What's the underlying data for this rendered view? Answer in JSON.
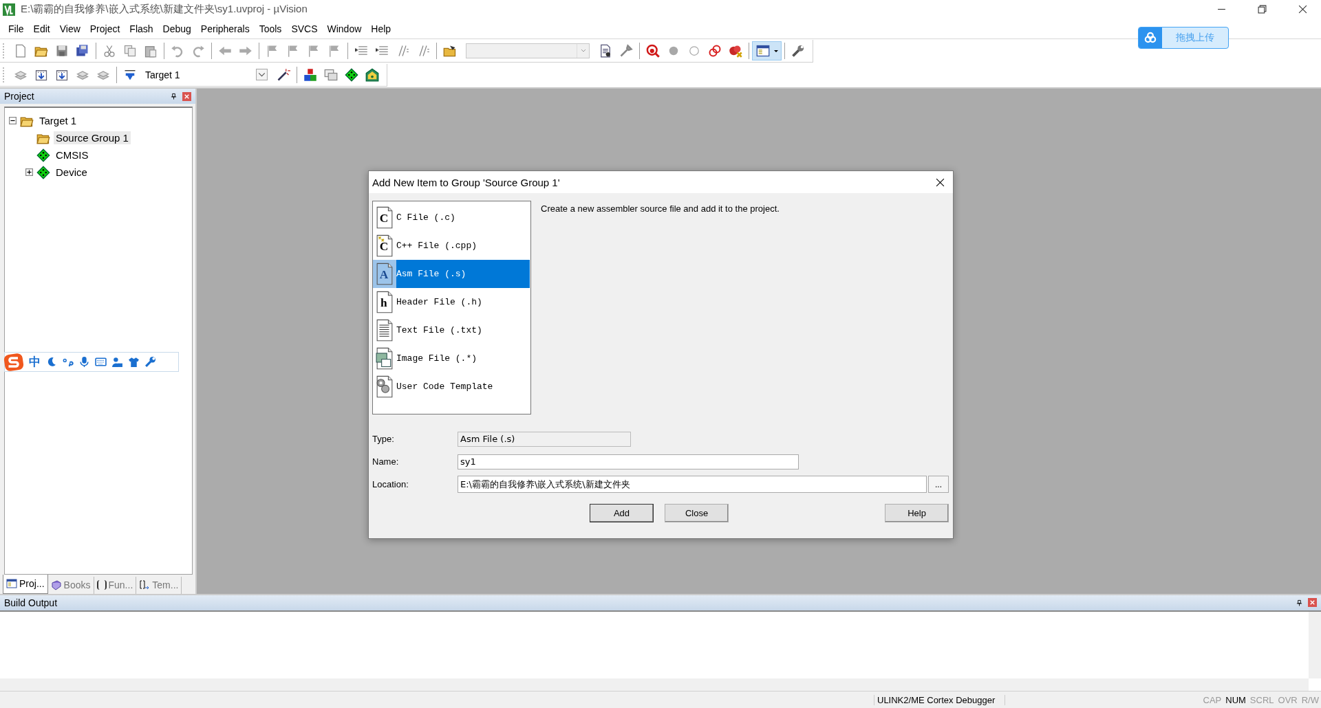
{
  "window": {
    "title": "E:\\霸霸的自我修养\\嵌入式系统\\新建文件夹\\sy1.uvproj - µVision"
  },
  "menu": [
    "File",
    "Edit",
    "View",
    "Project",
    "Flash",
    "Debug",
    "Peripherals",
    "Tools",
    "SVCS",
    "Window",
    "Help"
  ],
  "toolbar": {
    "target_select": "Target 1"
  },
  "upload_button": "拖拽上传",
  "ime_toolbar": {
    "mode": "中"
  },
  "project_panel": {
    "title": "Project",
    "tree": [
      {
        "label": "Target 1",
        "kind": "target",
        "expanded": true,
        "selected": false,
        "children": [
          {
            "label": "Source Group 1",
            "kind": "group",
            "selected": true
          },
          {
            "label": "CMSIS",
            "kind": "component",
            "selected": false
          },
          {
            "label": "Device",
            "kind": "component",
            "expanded": false,
            "selected": false
          }
        ]
      }
    ],
    "tabs": [
      {
        "label": "Proj...",
        "kind": "project",
        "selected": true
      },
      {
        "label": "Books",
        "kind": "books",
        "selected": false
      },
      {
        "label": "Fun...",
        "kind": "functions",
        "selected": false
      },
      {
        "label": "Tem...",
        "kind": "templates",
        "selected": false
      }
    ]
  },
  "dialog": {
    "title": "Add New Item to Group 'Source Group 1'",
    "items": [
      {
        "label": "C File (.c)",
        "kind": "c",
        "icon_letter": "C",
        "selected": false
      },
      {
        "label": "C++ File (.cpp)",
        "kind": "cpp",
        "icon_letter": "C",
        "selected": false
      },
      {
        "label": "Asm File (.s)",
        "kind": "asm",
        "icon_letter": "A",
        "selected": true
      },
      {
        "label": "Header File (.h)",
        "kind": "header",
        "icon_letter": "h",
        "selected": false
      },
      {
        "label": "Text File (.txt)",
        "kind": "text",
        "selected": false
      },
      {
        "label": "Image File (.*)",
        "kind": "image",
        "selected": false
      },
      {
        "label": "User Code Template",
        "kind": "template",
        "selected": false
      }
    ],
    "description": "Create a new assembler source file and add it to the project.",
    "type": {
      "label": "Type:",
      "value": "Asm File (.s)"
    },
    "name": {
      "label": "Name:",
      "value": "sy1"
    },
    "location": {
      "label": "Location:",
      "value": "E:\\霸霸的自我修养\\嵌入式系统\\新建文件夹"
    },
    "browse": "...",
    "buttons": [
      "Add",
      "Close",
      "Help"
    ]
  },
  "build_output": {
    "title": "Build Output"
  },
  "status_bar": {
    "debugger": "ULINK2/ME Cortex Debugger",
    "indicators": [
      {
        "label": "CAP",
        "on": false
      },
      {
        "label": "NUM",
        "on": true
      },
      {
        "label": "SCRL",
        "on": false
      },
      {
        "label": "OVR",
        "on": false
      },
      {
        "label": "R/W",
        "on": false
      }
    ]
  }
}
